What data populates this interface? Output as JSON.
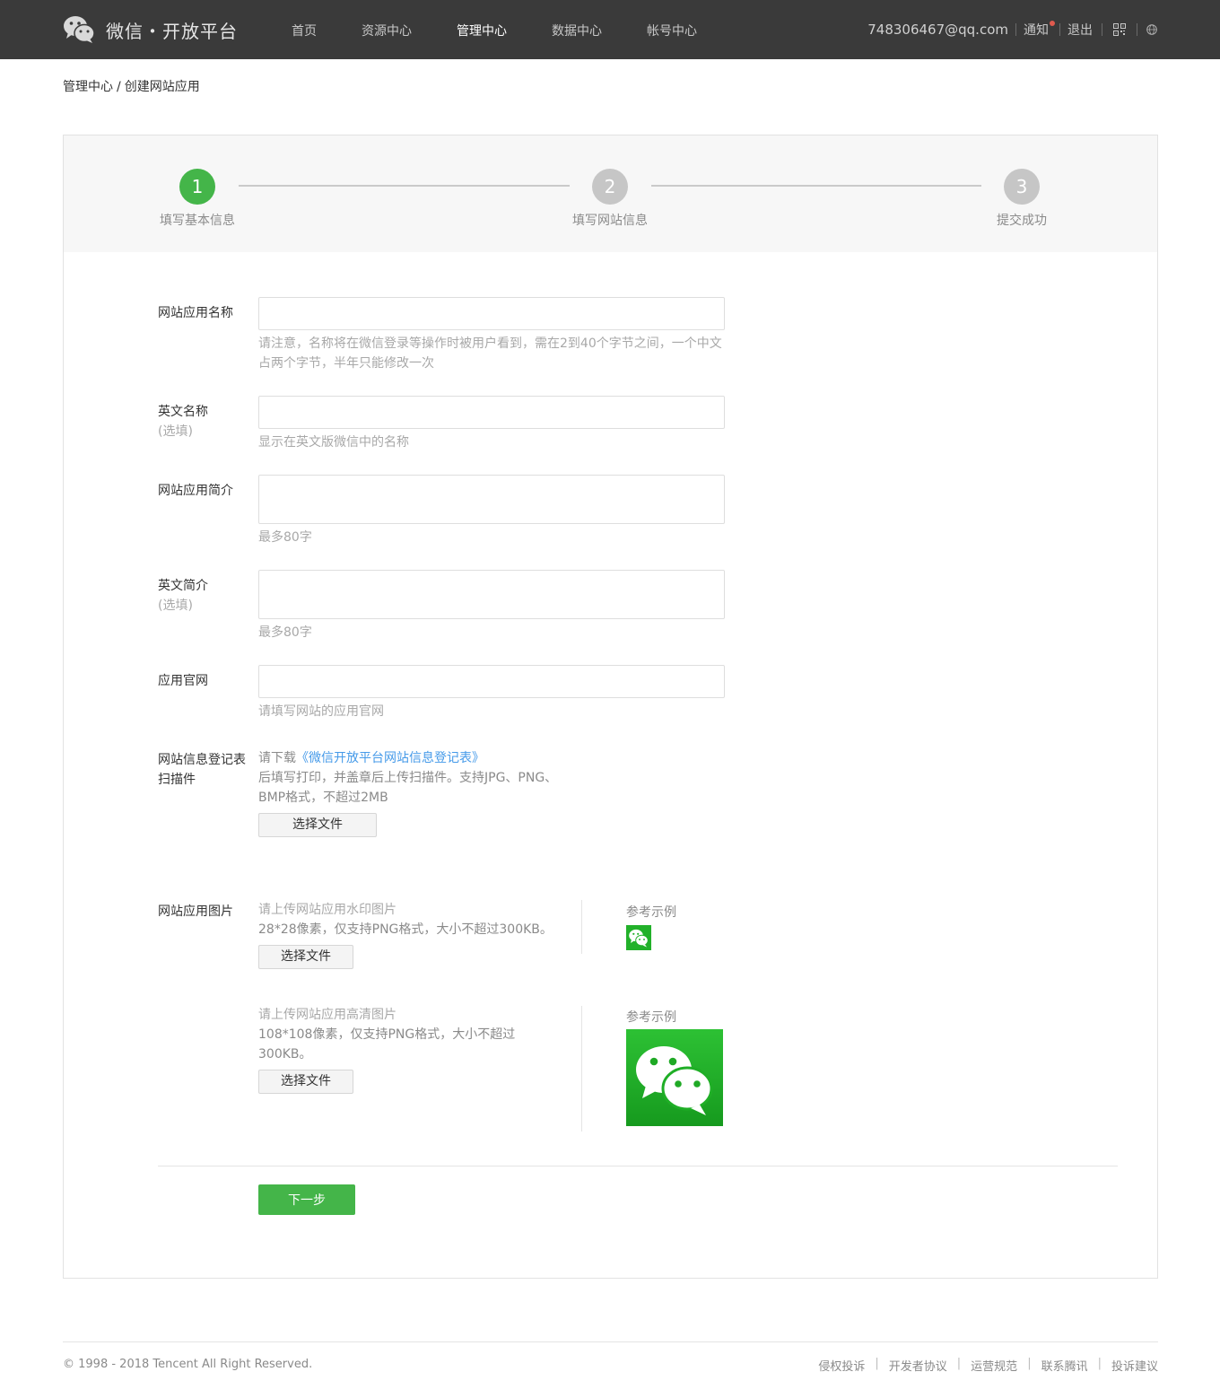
{
  "header": {
    "logo_text": "微信・开放平台",
    "nav": [
      "首页",
      "资源中心",
      "管理中心",
      "数据中心",
      "帐号中心"
    ],
    "active_nav": "管理中心",
    "email": "748306467@qq.com",
    "notice": "通知",
    "logout": "退出",
    "icons": [
      "wechat-logo-icon",
      "qrcode-icon",
      "globe-icon"
    ],
    "colors": {
      "bar": "#3a3a3a",
      "notice_dot": "#e05a4e"
    }
  },
  "breadcrumb": {
    "parent": "管理中心",
    "separator": "/",
    "current": "创建网站应用"
  },
  "steps": [
    {
      "number": "1",
      "label": "填写基本信息",
      "active": true
    },
    {
      "number": "2",
      "label": "填写网站信息",
      "active": false
    },
    {
      "number": "3",
      "label": "提交成功",
      "active": false
    }
  ],
  "form": {
    "app_name": {
      "label": "网站应用名称",
      "value": "",
      "tip": "请注意，名称将在微信登录等操作时被用户看到，需在2到40个字节之间，一个中文占两个字节，半年只能修改一次"
    },
    "en_name": {
      "label": "英文名称",
      "optional": "(选填)",
      "value": "",
      "tip": "显示在英文版微信中的名称"
    },
    "intro": {
      "label": "网站应用简介",
      "value": "",
      "tip": "最多80字"
    },
    "en_intro": {
      "label": "英文简介",
      "optional": "(选填)",
      "value": "",
      "tip": "最多80字"
    },
    "website": {
      "label": "应用官网",
      "value": "",
      "tip": "请填写网站的应用官网"
    },
    "scan": {
      "label_line1": "网站信息登记表",
      "label_line2": "扫描件",
      "tip_prefix": "请下载",
      "tip_link": "《微信开放平台网站信息登记表》",
      "tip_rest": "后填写打印，并盖章后上传扫描件。支持JPG、PNG、BMP格式，不超过2MB",
      "button": "选择文件"
    },
    "images": {
      "label": "网站应用图片",
      "small": {
        "title": "请上传网站应用水印图片",
        "desc": "28*28像素，仅支持PNG格式，大小不超过300KB。",
        "button": "选择文件",
        "ref_title": "参考示例"
      },
      "large": {
        "title": "请上传网站应用高清图片",
        "desc": "108*108像素，仅支持PNG格式，大小不超过300KB。",
        "button": "选择文件",
        "ref_title": "参考示例"
      }
    },
    "next_button": "下一步",
    "colors": {
      "primary": "#44b549",
      "link": "#459ae9"
    }
  },
  "footer": {
    "copyright": "© 1998 - 2018 Tencent All Right Reserved.",
    "links": [
      "侵权投诉",
      "开发者协议",
      "运营规范",
      "联系腾讯",
      "投诉建议"
    ],
    "separator": "|"
  }
}
